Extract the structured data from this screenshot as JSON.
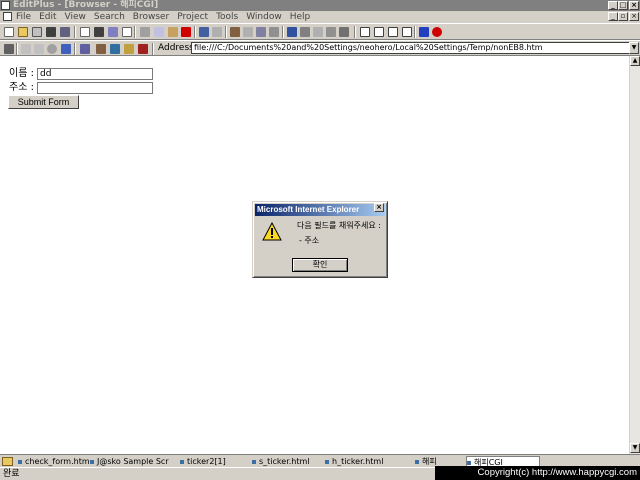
{
  "window": {
    "title": "EditPlus - [Browser - 해피CGI]",
    "min": "_",
    "max": "□",
    "close": "×"
  },
  "menu": {
    "items": [
      "File",
      "Edit",
      "View",
      "Search",
      "Browser",
      "Project",
      "Tools",
      "Window",
      "Help"
    ]
  },
  "browser": {
    "address_label": "Address",
    "address_value": "file:///C:/Documents%20and%20Settings/neohero/Local%20Settings/Temp/nonEB8.htm"
  },
  "form": {
    "name_label": "이름 :",
    "name_value": "dd",
    "address_label": "주소 :",
    "address_value": "",
    "submit_label": "Submit Form"
  },
  "dialog": {
    "title": "Microsoft Internet Explorer",
    "message_line1": "다음 필드를 채워주세요 :",
    "message_line2": "- 주소",
    "ok_label": "확인",
    "close": "×"
  },
  "doc_tabs": [
    {
      "label": "check_form.html",
      "active": false
    },
    {
      "label": "J@sko Sample Scr",
      "active": false
    },
    {
      "label": "ticker2[1]",
      "active": false
    },
    {
      "label": "s_ticker.html",
      "active": false
    },
    {
      "label": "h_ticker.html",
      "active": false
    },
    {
      "label": "해피",
      "active": false
    },
    {
      "label": "해피CGI",
      "active": true
    }
  ],
  "status": {
    "text": "완료"
  },
  "watermark": {
    "text": "Copyright(c) http://www.happycgi.com"
  },
  "colors": {
    "title_inactive": "#808080",
    "dialog_title": "#0a246a",
    "face": "#d4d0c8"
  }
}
